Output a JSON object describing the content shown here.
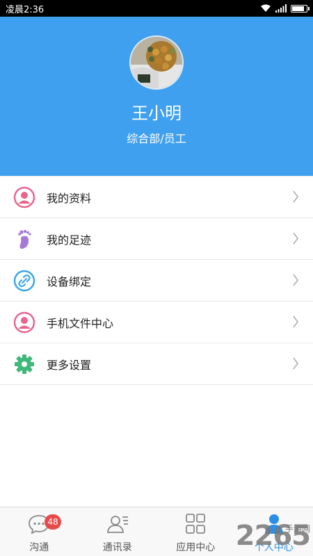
{
  "status_bar": {
    "time": "凌晨2:36",
    "battery_level": 0.9
  },
  "profile": {
    "name": "王小明",
    "department": "综合部/员工"
  },
  "menu": [
    {
      "label": "我的资料",
      "icon": "person-circle-icon",
      "color": "#e8658f"
    },
    {
      "label": "我的足迹",
      "icon": "footprint-icon",
      "color": "#a678d8"
    },
    {
      "label": "设备绑定",
      "icon": "link-icon",
      "color": "#3aa7e8"
    },
    {
      "label": "手机文件中心",
      "icon": "person-circle-icon",
      "color": "#e8658f"
    },
    {
      "label": "更多设置",
      "icon": "gear-icon",
      "color": "#3fb87a"
    }
  ],
  "tabbar": {
    "items": [
      {
        "label": "沟通",
        "icon": "chat-icon",
        "badge": "48"
      },
      {
        "label": "通讯录",
        "icon": "contacts-icon"
      },
      {
        "label": "应用中心",
        "icon": "grid-icon"
      },
      {
        "label": "个人中心",
        "icon": "person-icon",
        "active": true
      }
    ]
  },
  "watermark": {
    "text": "2265",
    "sub": "手游网"
  },
  "colors": {
    "header_bg": "#3fa0ef",
    "accent": "#2b8fe5",
    "badge": "#e84a4a"
  }
}
